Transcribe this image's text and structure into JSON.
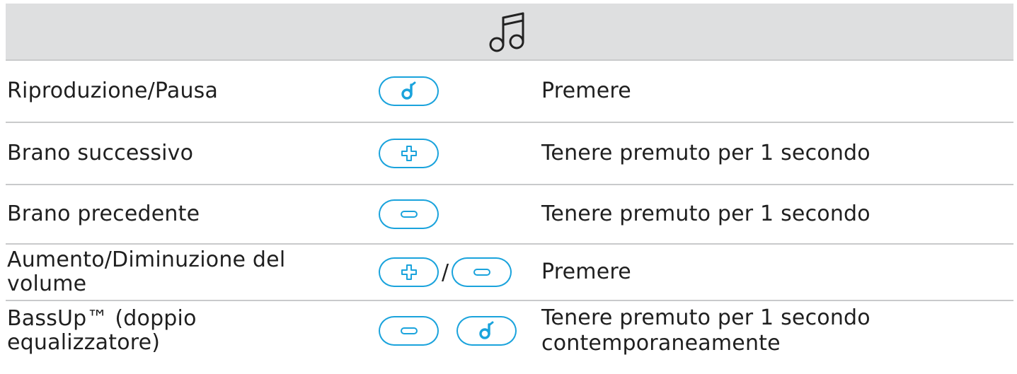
{
  "header": {
    "icon": "music-note-icon"
  },
  "colors": {
    "accent": "#1aa3dc",
    "header_bg": "#dedfe0",
    "divider": "#c9cacb"
  },
  "rows": [
    {
      "label": "Riproduzione/Pausa",
      "buttons": [
        "play-pause-icon"
      ],
      "action": "Premere"
    },
    {
      "label": "Brano successivo",
      "buttons": [
        "plus-icon"
      ],
      "action": "Tenere premuto per 1 secondo"
    },
    {
      "label": "Brano precedente",
      "buttons": [
        "minus-icon"
      ],
      "action": "Tenere premuto per 1 secondo"
    },
    {
      "label": "Aumento/Diminuzione del\nvolume",
      "buttons": [
        "plus-icon",
        "minus-icon"
      ],
      "separator": "/",
      "action": "Premere"
    },
    {
      "label": "BassUp™ (doppio\nequalizzatore)",
      "buttons": [
        "minus-icon",
        "play-pause-icon"
      ],
      "action": "Tenere premuto per 1 secondo\ncontemporaneamente"
    }
  ]
}
